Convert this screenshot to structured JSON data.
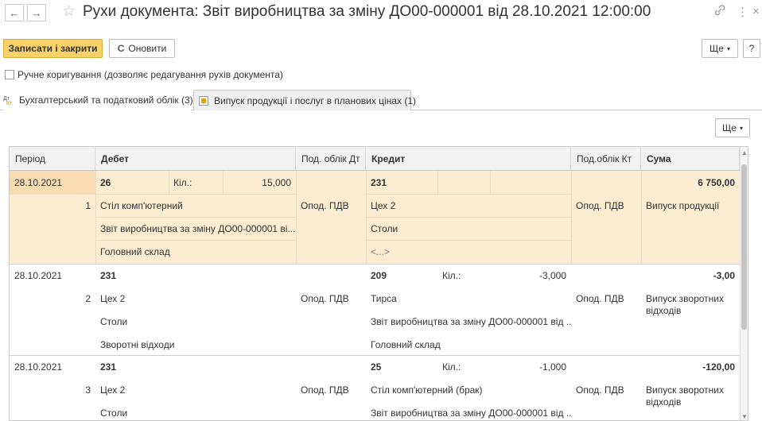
{
  "window": {
    "title": "Рухи документа: Звіт виробництва за зміну ДО00-000001 від 28.10.2021 12:00:00",
    "back_glyph": "←",
    "forward_glyph": "→",
    "star_glyph": "☆",
    "link_glyph": "🔗",
    "more_glyph": "⋮",
    "close_glyph": "×"
  },
  "toolbar": {
    "save_close_label": "Записати і закрити",
    "refresh_label": "Оновити",
    "refresh_glyph": "C",
    "more_label": "Ще",
    "more_arrow": "▾",
    "help_label": "?"
  },
  "manual_edit": {
    "label": "Ручне коригування (дозволяє редагування рухів документа)",
    "checked": false
  },
  "tabs": [
    {
      "label": "Бухгалтерський та податковий облік (3)",
      "active": true,
      "icon": "dt-kt-icon"
    },
    {
      "label": "Випуск продукції і послуг в планових цінах (1)",
      "active": false,
      "icon": "register-icon"
    }
  ],
  "grid_toolbar": {
    "more_label": "Ще",
    "more_arrow": "▾"
  },
  "columns": {
    "period": "Період",
    "debit": "Дебет",
    "sub_dt": "Под. облік Дт",
    "credit": "Кредит",
    "sub_kt": "Под.облік Кт",
    "sum": "Сума"
  },
  "rows": [
    {
      "period": "28.10.2021",
      "num": "1",
      "debit_account": "26",
      "debit_qty_label": "Кіл.:",
      "debit_qty": "15,000",
      "debit_sub": [
        "Стіл комп'ютерний",
        "Звіт виробництва за зміну ДО00-000001 ві...",
        "Головний склад"
      ],
      "sub_dt": "Опод. ПДВ",
      "credit_account": "231",
      "credit_qty_label": "",
      "credit_qty": "",
      "credit_sub": [
        "Цех 2",
        "Столи",
        "<...>"
      ],
      "sub_kt": "Опод. ПДВ",
      "sum": "6 750,00",
      "content": "Випуск продукції",
      "selected": true
    },
    {
      "period": "28.10.2021",
      "num": "2",
      "debit_account": "231",
      "debit_qty_label": "",
      "debit_qty": "",
      "debit_sub": [
        "Цех 2",
        "Столи",
        "Зворотні відходи"
      ],
      "sub_dt": "Опод. ПДВ",
      "credit_account": "209",
      "credit_qty_label": "Кіл.:",
      "credit_qty": "-3,000",
      "credit_sub": [
        "Тирса",
        "Звіт виробництва за зміну ДО00-000001 від ...",
        "Головний склад"
      ],
      "sub_kt": "Опод. ПДВ",
      "sum": "-3,00",
      "content": "Випуск зворотних відходів",
      "selected": false
    },
    {
      "period": "28.10.2021",
      "num": "3",
      "debit_account": "231",
      "debit_qty_label": "",
      "debit_qty": "",
      "debit_sub": [
        "Цех 2",
        "Столи"
      ],
      "sub_dt": "Опод. ПДВ",
      "credit_account": "25",
      "credit_qty_label": "Кіл.:",
      "credit_qty": "-1,000",
      "credit_sub": [
        "Стіл комп'ютерний (брак)",
        "Звіт виробництва за зміну ДО00-000001 від ..."
      ],
      "sub_kt": "Опод. ПДВ",
      "sum": "-120,00",
      "content": "Випуск зворотних відходів",
      "selected": false
    }
  ],
  "colors": {
    "accent_button": "#fbd26a",
    "selected_row": "#fbecd2",
    "header_bg": "#f2f2f2"
  }
}
